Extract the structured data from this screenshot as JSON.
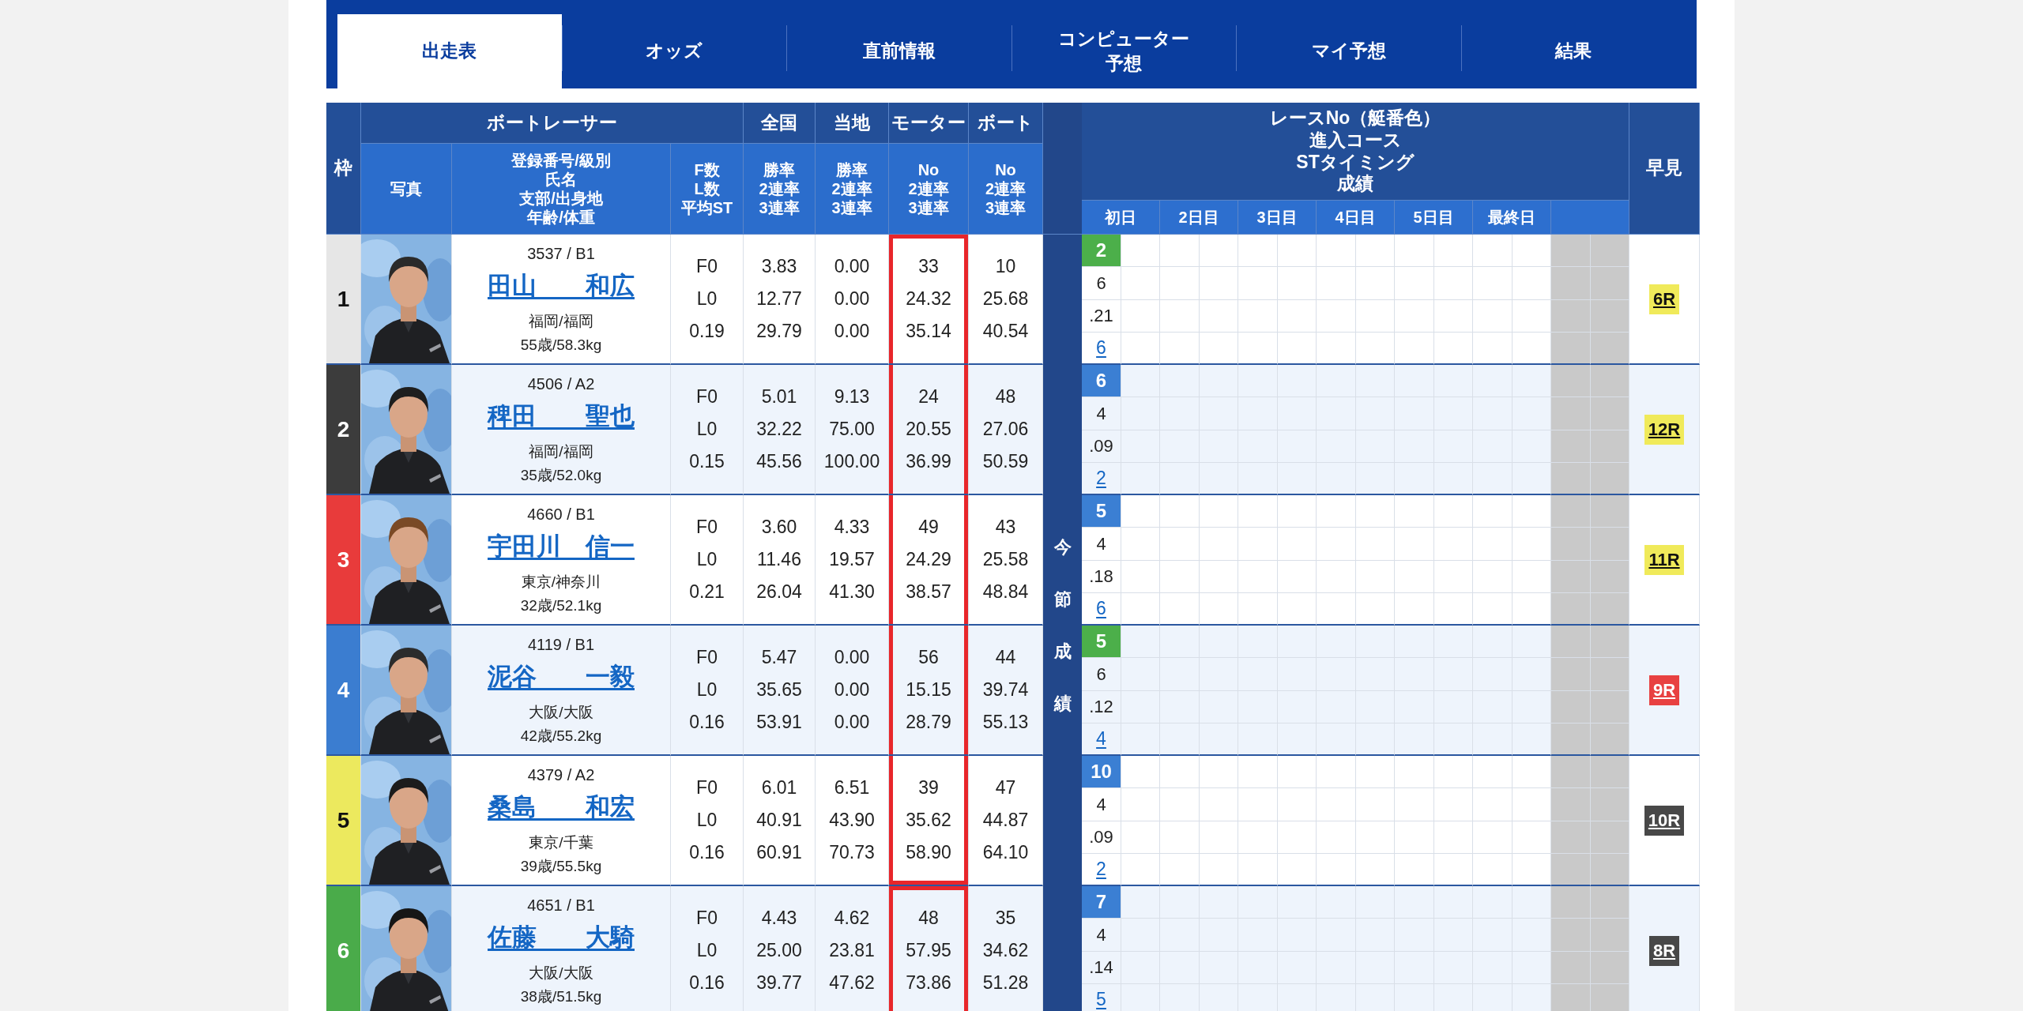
{
  "tabs": [
    {
      "label": "出走表",
      "selected": true
    },
    {
      "label": "オッズ",
      "selected": false
    },
    {
      "label": "直前情報",
      "selected": false
    },
    {
      "label": "コンピューター予想",
      "selected": false
    },
    {
      "label": "マイ予想",
      "selected": false
    },
    {
      "label": "結果",
      "selected": false
    }
  ],
  "table": {
    "frame": "枠",
    "racer": "ボートレーサー",
    "national": "全国",
    "local": "当地",
    "motor": "モーター",
    "boat": "ボート",
    "photo": "写真",
    "info": [
      "登録番号/級別",
      "氏名",
      "支部/出身地",
      "年齢/体重"
    ],
    "fl": [
      "F数",
      "L数",
      "平均ST"
    ],
    "national_sub": [
      "勝率",
      "2連率",
      "3連率"
    ],
    "local_sub": [
      "勝率",
      "2連率",
      "3連率"
    ],
    "motor_sub": [
      "No",
      "2連率",
      "3連率"
    ],
    "boat_sub": [
      "No",
      "2連率",
      "3連率"
    ],
    "race": [
      "レースNo（艇番色）",
      "進入コース",
      "STタイミング",
      "成績"
    ],
    "quick": "早見",
    "days": [
      "初日",
      "2日目",
      "3日目",
      "4日目",
      "5日目",
      "最終日"
    ],
    "section": "今節成績"
  },
  "racers": [
    {
      "frame": "1",
      "color": "#e6e6e6",
      "registration": "3537 / B1",
      "name": "田山　　和広",
      "branch": "福岡/福岡",
      "age_weight": "55歳/58.3kg",
      "fl": [
        "F0",
        "L0",
        "0.19"
      ],
      "national": [
        "3.83",
        "12.77",
        "29.79"
      ],
      "local": [
        "0.00",
        "0.00",
        "0.00"
      ],
      "motor": [
        "33",
        "24.32",
        "35.14"
      ],
      "boat": [
        "10",
        "25.68",
        "40.54"
      ],
      "motor_marked": true,
      "mark_starts": true,
      "mark_ends": false,
      "day1": {
        "race": {
          "label": "2",
          "color": "#4caf4a"
        },
        "course": "6",
        "st": ".21",
        "result": "6"
      },
      "quick": {
        "label": "6R",
        "color": "#f0ea5a"
      }
    },
    {
      "frame": "2",
      "color": "#3c3c3c",
      "registration": "4506 / A2",
      "name": "稗田　　聖也",
      "branch": "福岡/福岡",
      "age_weight": "35歳/52.0kg",
      "fl": [
        "F0",
        "L0",
        "0.15"
      ],
      "national": [
        "5.01",
        "32.22",
        "45.56"
      ],
      "local": [
        "9.13",
        "75.00",
        "100.00"
      ],
      "motor": [
        "24",
        "20.55",
        "36.99"
      ],
      "boat": [
        "48",
        "27.06",
        "50.59"
      ],
      "motor_marked": true,
      "mark_starts": false,
      "mark_ends": false,
      "day1": {
        "race": {
          "label": "6",
          "color": "#3b7fd3"
        },
        "course": "4",
        "st": ".09",
        "result": "2"
      },
      "quick": {
        "label": "12R",
        "color": "#f0ea5a"
      }
    },
    {
      "frame": "3",
      "color": "#e83b3b",
      "registration": "4660 / B1",
      "name": "宇田川　信一",
      "branch": "東京/神奈川",
      "age_weight": "32歳/52.1kg",
      "fl": [
        "F0",
        "L0",
        "0.21"
      ],
      "national": [
        "3.60",
        "11.46",
        "26.04"
      ],
      "local": [
        "4.33",
        "19.57",
        "41.30"
      ],
      "motor": [
        "49",
        "24.29",
        "38.57"
      ],
      "boat": [
        "43",
        "25.58",
        "48.84"
      ],
      "motor_marked": true,
      "mark_starts": false,
      "mark_ends": false,
      "day1": {
        "race": {
          "label": "5",
          "color": "#3b7fd3"
        },
        "course": "4",
        "st": ".18",
        "result": "6"
      },
      "quick": {
        "label": "11R",
        "color": "#f0ea5a"
      }
    },
    {
      "frame": "4",
      "color": "#3b7dd0",
      "registration": "4119 / B1",
      "name": "泥谷　　一毅",
      "branch": "大阪/大阪",
      "age_weight": "42歳/55.2kg",
      "fl": [
        "F0",
        "L0",
        "0.16"
      ],
      "national": [
        "5.47",
        "35.65",
        "53.91"
      ],
      "local": [
        "0.00",
        "0.00",
        "0.00"
      ],
      "motor": [
        "56",
        "15.15",
        "28.79"
      ],
      "boat": [
        "44",
        "39.74",
        "55.13"
      ],
      "motor_marked": true,
      "mark_starts": false,
      "mark_ends": false,
      "day1": {
        "race": {
          "label": "5",
          "color": "#4caf4a"
        },
        "course": "6",
        "st": ".12",
        "result": "4"
      },
      "quick": {
        "label": "9R",
        "color": "#e84141"
      }
    },
    {
      "frame": "5",
      "color": "#ece95e",
      "registration": "4379 / A2",
      "name": "桑島　　和宏",
      "branch": "東京/千葉",
      "age_weight": "39歳/55.5kg",
      "fl": [
        "F0",
        "L0",
        "0.16"
      ],
      "national": [
        "6.01",
        "40.91",
        "60.91"
      ],
      "local": [
        "6.51",
        "43.90",
        "70.73"
      ],
      "motor": [
        "39",
        "35.62",
        "58.90"
      ],
      "boat": [
        "47",
        "44.87",
        "64.10"
      ],
      "motor_marked": true,
      "mark_starts": false,
      "mark_ends": true,
      "day1": {
        "race": {
          "label": "10",
          "color": "#3b7fd3"
        },
        "course": "4",
        "st": ".09",
        "result": "2"
      },
      "quick": {
        "label": "10R",
        "color": "#484848"
      }
    },
    {
      "frame": "6",
      "color": "#4aab4a",
      "registration": "4651 / B1",
      "name": "佐藤　　大騎",
      "branch": "大阪/大阪",
      "age_weight": "38歳/51.5kg",
      "fl": [
        "F0",
        "L0",
        "0.16"
      ],
      "national": [
        "4.43",
        "25.00",
        "39.77"
      ],
      "local": [
        "4.62",
        "23.81",
        "47.62"
      ],
      "motor": [
        "48",
        "57.95",
        "73.86"
      ],
      "boat": [
        "35",
        "34.62",
        "51.28"
      ],
      "motor_marked": true,
      "mark_starts": true,
      "mark_ends": true,
      "day1": {
        "race": {
          "label": "7",
          "color": "#3b7fd3"
        },
        "course": "4",
        "st": ".14",
        "result": "5"
      },
      "quick": {
        "label": "8R",
        "color": "#484848"
      }
    }
  ]
}
